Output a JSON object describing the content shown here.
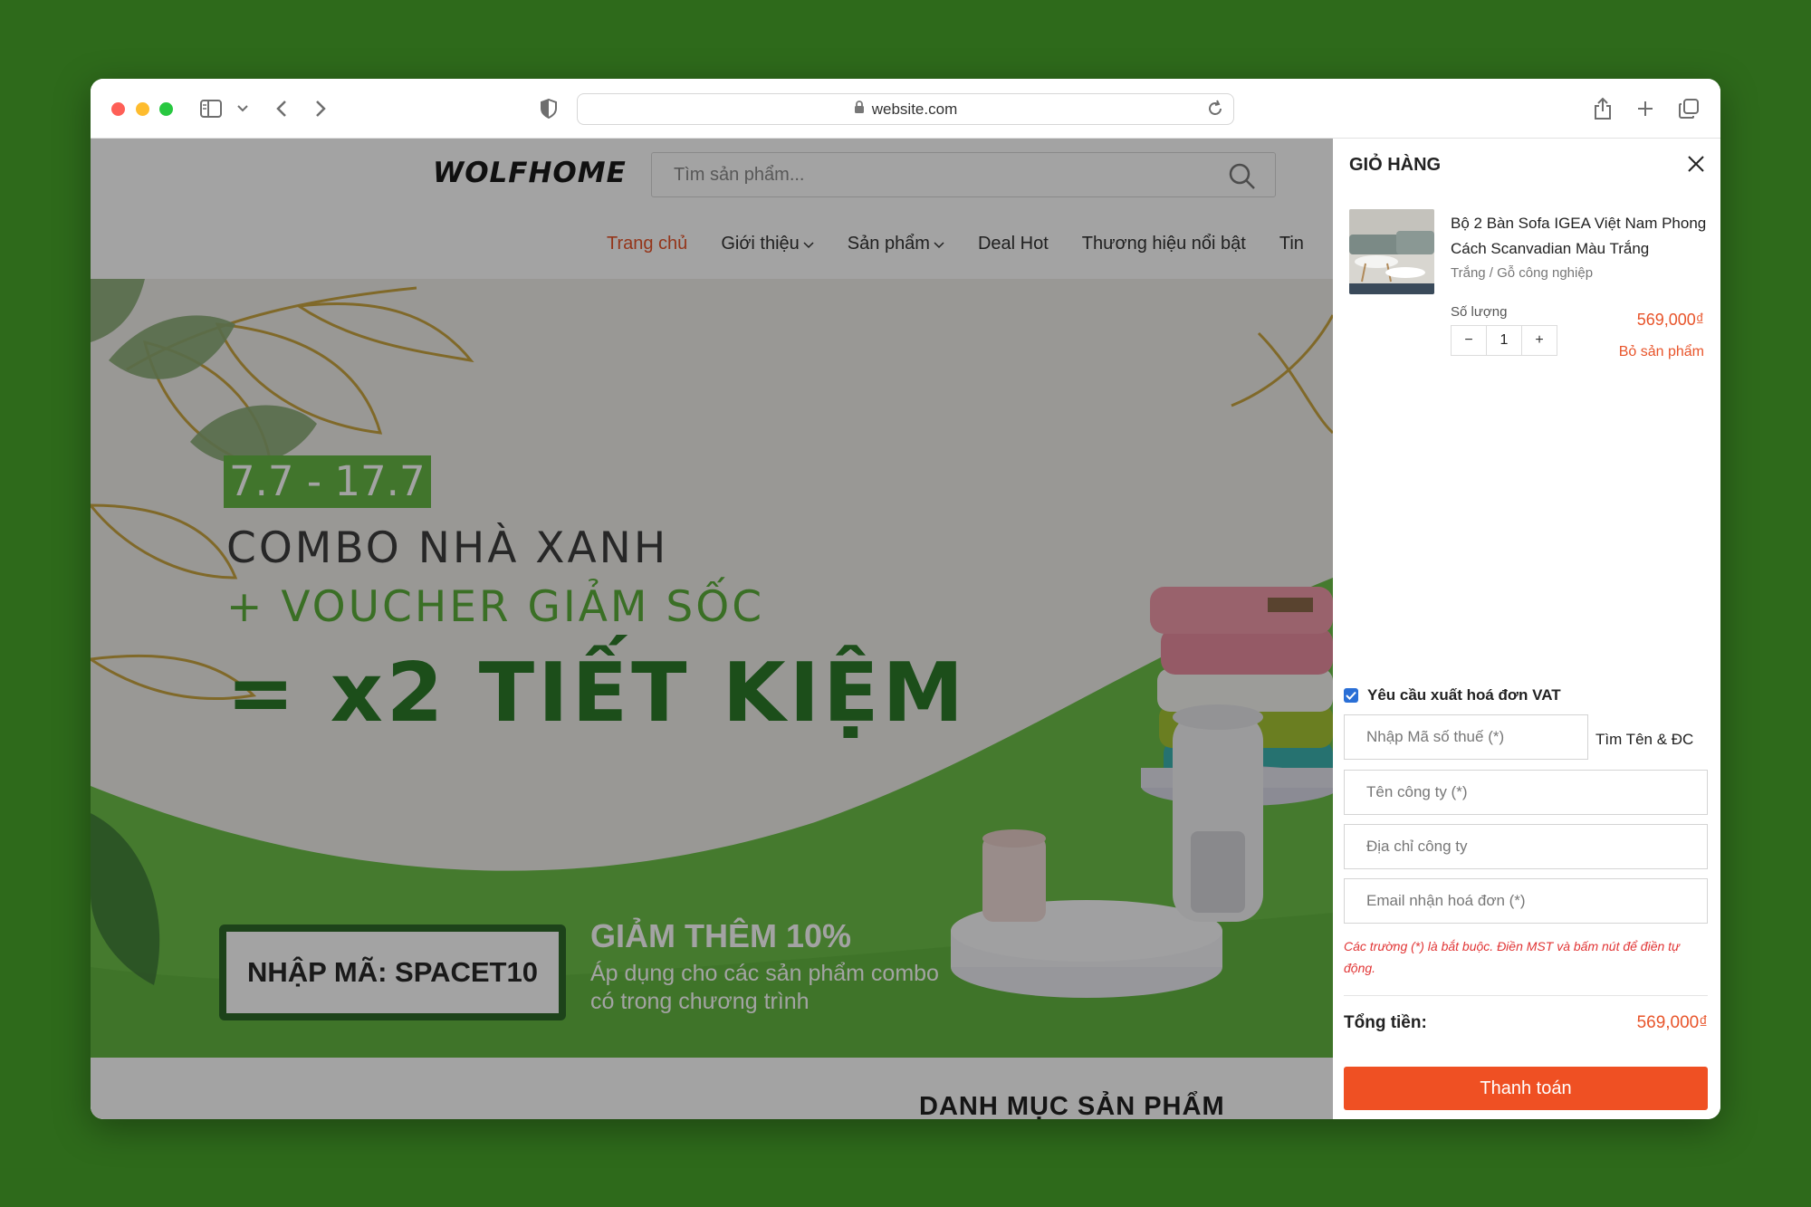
{
  "browser": {
    "url": "website.com"
  },
  "site": {
    "logo": "WOLFHOME",
    "search_placeholder": "Tìm sản phẩm...",
    "nav": [
      "Trang chủ",
      "Giới thiệu",
      "Sản phẩm",
      "Deal Hot",
      "Thương hiệu nổi bật",
      "Tin"
    ]
  },
  "banner": {
    "date": "7.7 - 17.7",
    "line1": "COMBO NHÀ XANH",
    "line2": "+ VOUCHER GIẢM SỐC",
    "line3": "= x2 TIẾT KIỆM",
    "code": "NHẬP MÃ: SPACET10",
    "promo_title": "GIẢM THÊM 10%",
    "promo_sub": "Áp dụng cho các sản phẩm combo có trong chương trình"
  },
  "section_title": "DANH MỤC SẢN PHẨM",
  "cart": {
    "title": "GIỎ HÀNG",
    "item": {
      "name": "Bộ 2 Bàn Sofa IGEA Việt Nam Phong Cách Scanvadian Màu Trắng",
      "variant": "Trắng / Gỗ công nghiệp",
      "qty_label": "Số lượng",
      "qty": "1",
      "minus": "−",
      "plus": "+",
      "price": "569,000₫",
      "remove": "Bỏ sản phẩm"
    },
    "vat_label": "Yêu cầu xuất hoá đơn VAT",
    "vat_checked": true,
    "tax_placeholder": "Nhập Mã số thuế (*)",
    "lookup": "Tìm Tên & ĐC",
    "company_placeholder": "Tên công ty (*)",
    "address_placeholder": "Địa chỉ công ty",
    "email_placeholder": "Email nhận hoá đơn (*)",
    "note": "Các trường (*) là bắt buộc. Điền MST và bấm nút để điền tự động.",
    "total_label": "Tổng tiền:",
    "total": "569,000₫",
    "checkout": "Thanh toán"
  },
  "colors": {
    "accent": "#e8542a",
    "button": "#ef5023",
    "brand_green": "#5cae3a",
    "background": "#2e6a1b"
  }
}
